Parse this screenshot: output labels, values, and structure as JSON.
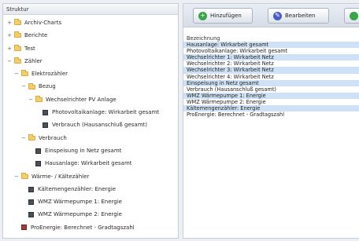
{
  "tree": {
    "header": "Struktur",
    "items": [
      {
        "label": "Archiv-Charts",
        "toggle": "+",
        "kind": "folder",
        "depth": 0
      },
      {
        "label": "Berichte",
        "toggle": "+",
        "kind": "folder",
        "depth": 0
      },
      {
        "label": "Test",
        "toggle": "+",
        "kind": "folder",
        "depth": 0
      },
      {
        "label": "Zähler",
        "toggle": "−",
        "kind": "folder",
        "depth": 0
      },
      {
        "label": "Elektrozähler",
        "toggle": "−",
        "kind": "folder",
        "depth": 1
      },
      {
        "label": "Bezug",
        "toggle": "−",
        "kind": "folder",
        "depth": 2
      },
      {
        "label": "Wechselrichter PV Anlage",
        "toggle": "−",
        "kind": "folder",
        "depth": 3
      },
      {
        "label": "Photovoltaikanlage: Wirkarbeit gesamt",
        "toggle": "",
        "kind": "leaf",
        "depth": 4
      },
      {
        "label": "Verbrauch (Hausanschluß gesamt)",
        "toggle": "",
        "kind": "leaf",
        "depth": 4
      },
      {
        "label": "Verbrauch",
        "toggle": "−",
        "kind": "folder",
        "depth": 2
      },
      {
        "label": "Einspeisung in Netz gesamt",
        "toggle": "",
        "kind": "leaf",
        "depth": 3
      },
      {
        "label": "Hausanlage: Wirkarbeit gesamt",
        "toggle": "",
        "kind": "leaf",
        "depth": 3
      },
      {
        "label": "Wärme- / Kältezähler",
        "toggle": "−",
        "kind": "folder",
        "depth": 1
      },
      {
        "label": "Kältemengenzähler: Energie",
        "toggle": "",
        "kind": "leaf",
        "depth": 2
      },
      {
        "label": "WMZ Wärmepumpe 1: Energie",
        "toggle": "",
        "kind": "leaf",
        "depth": 2
      },
      {
        "label": "WMZ Wärmepumpe 2: Energie",
        "toggle": "",
        "kind": "leaf",
        "depth": 2
      },
      {
        "label": "ProEnergie: Berechnet - Gradtagszahl",
        "toggle": "",
        "kind": "leaf-red",
        "depth": 1
      }
    ]
  },
  "toolbar": {
    "add_label": "Hinzufügen",
    "add_icon": "plus-icon",
    "edit_label": "Bearbeiten",
    "edit_icon": "pencil-icon"
  },
  "list": {
    "header": "Bezeichnung",
    "rows": [
      {
        "label": "Hausanlage: Wirkarbeit gesamt",
        "highlight": true
      },
      {
        "label": "Photovoltaikanlage: Wirkarbeit gesamt",
        "highlight": false
      },
      {
        "label": "Wechselrichter 1: Wirkarbeit Netz",
        "highlight": true
      },
      {
        "label": "Wechselrichter 2: Wirkarbeit Netz",
        "highlight": false
      },
      {
        "label": "Wechselrichter 3: Wirkarbeit Netz",
        "highlight": true
      },
      {
        "label": "Wechselrichter 4: Wirkarbeit Netz",
        "highlight": false
      },
      {
        "label": "Einspeisung in Netz gesamt",
        "highlight": true
      },
      {
        "label": "Verbrauch (Hausanschluß gesamt)",
        "highlight": false
      },
      {
        "label": "WMZ Wärmepumpe 1: Energie",
        "highlight": true
      },
      {
        "label": "WMZ Wärmepumpe 2: Energie",
        "highlight": false
      },
      {
        "label": "Kältemengenzähler: Energie",
        "highlight": true
      },
      {
        "label": "ProEnergie: Berechnet - Gradtagszahl",
        "highlight": false
      }
    ]
  },
  "colors": {
    "highlight_row": "#cfe1f4",
    "add_icon": "#3aa548",
    "edit_icon": "#4a5cc7",
    "folder": "#f2cf6a"
  }
}
